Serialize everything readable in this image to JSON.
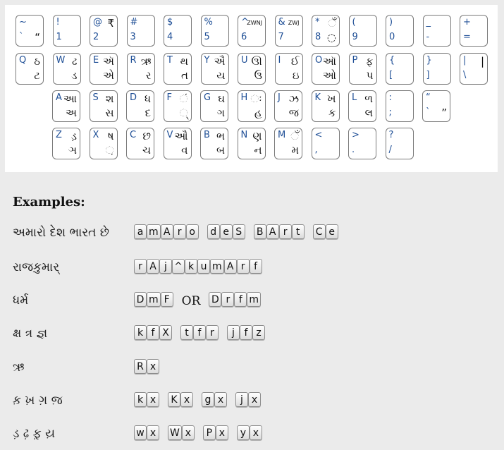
{
  "keyboard": {
    "rows": [
      [
        {
          "shift": "~",
          "base": "`",
          "gs": "",
          "gb": "“"
        },
        {
          "shift": "!",
          "base": "1",
          "gs": "",
          "gb": ""
        },
        {
          "shift": "@",
          "base": "2",
          "gs": "₹",
          "gb": ""
        },
        {
          "shift": "#",
          "base": "3",
          "gs": "",
          "gb": ""
        },
        {
          "shift": "$",
          "base": "4",
          "gs": "",
          "gb": ""
        },
        {
          "shift": "%",
          "base": "5",
          "gs": "",
          "gb": ""
        },
        {
          "shift": "^",
          "base": "6",
          "gs": "ZWNJ",
          "gb": "",
          "tiny": true
        },
        {
          "shift": "&",
          "base": "7",
          "gs": "ZWJ",
          "gb": "",
          "tiny": true
        },
        {
          "shift": "*",
          "base": "8",
          "gs": "ઁ",
          "gb": "◌"
        },
        {
          "shift": "(",
          "base": "9",
          "gs": "",
          "gb": ""
        },
        {
          "shift": ")",
          "base": "0",
          "gs": "",
          "gb": ""
        },
        {
          "shift": "_",
          "base": "-",
          "gs": "",
          "gb": ""
        },
        {
          "shift": "+",
          "base": "=",
          "gs": "",
          "gb": ""
        }
      ],
      [
        {
          "shift": "Q",
          "base": "",
          "gs": "ઠ",
          "gb": "ટ"
        },
        {
          "shift": "W",
          "base": "",
          "gs": "ઢ",
          "gb": "ડ"
        },
        {
          "shift": "E",
          "base": "",
          "gs": "ઍ",
          "gb": "એ"
        },
        {
          "shift": "R",
          "base": "",
          "gs": "ઋ",
          "gb": "ર"
        },
        {
          "shift": "T",
          "base": "",
          "gs": "થ",
          "gb": "ત"
        },
        {
          "shift": "Y",
          "base": "",
          "gs": "ઐ",
          "gb": "ય"
        },
        {
          "shift": "U",
          "base": "",
          "gs": "ઊ",
          "gb": "ઉ"
        },
        {
          "shift": "I",
          "base": "",
          "gs": "ઈ",
          "gb": "ઇ"
        },
        {
          "shift": "O",
          "base": "",
          "gs": "ઑ",
          "gb": "ઓ"
        },
        {
          "shift": "P",
          "base": "",
          "gs": "ફ",
          "gb": "પ"
        },
        {
          "shift": "{",
          "base": "[",
          "gs": "",
          "gb": ""
        },
        {
          "shift": "}",
          "base": "]",
          "gs": "",
          "gb": ""
        },
        {
          "shift": "|",
          "base": "\\",
          "gs": "|",
          "gb": ""
        }
      ],
      [
        {
          "shift": "A",
          "base": "",
          "gs": "આ",
          "gb": "અ"
        },
        {
          "shift": "S",
          "base": "",
          "gs": "શ",
          "gb": "સ"
        },
        {
          "shift": "D",
          "base": "",
          "gs": "ધ",
          "gb": "દ"
        },
        {
          "shift": "F",
          "base": "",
          "gs": "ં",
          "gb": "્"
        },
        {
          "shift": "G",
          "base": "",
          "gs": "ઘ",
          "gb": "ગ"
        },
        {
          "shift": "H",
          "base": "",
          "gs": "ઃ",
          "gb": "હ"
        },
        {
          "shift": "J",
          "base": "",
          "gs": "ઝ",
          "gb": "જ"
        },
        {
          "shift": "K",
          "base": "",
          "gs": "ખ",
          "gb": "ક"
        },
        {
          "shift": "L",
          "base": "",
          "gs": "ળ",
          "gb": "લ"
        },
        {
          "shift": ":",
          "base": ";",
          "gs": "",
          "gb": ""
        },
        {
          "shift": "“",
          "base": "`",
          "gs": "",
          "gb": "”"
        }
      ],
      [
        {
          "shift": "Z",
          "base": "",
          "gs": "ડ઼",
          "gb": "ઞ"
        },
        {
          "shift": "X",
          "base": "",
          "gs": "ષ",
          "gb": "઼"
        },
        {
          "shift": "C",
          "base": "",
          "gs": "છ",
          "gb": "ચ"
        },
        {
          "shift": "V",
          "base": "",
          "gs": "ઔ",
          "gb": "વ"
        },
        {
          "shift": "B",
          "base": "",
          "gs": "ભ",
          "gb": "બ"
        },
        {
          "shift": "N",
          "base": "",
          "gs": "ણ",
          "gb": "ન"
        },
        {
          "shift": "M",
          "base": "",
          "gs": "ઁ",
          "gb": "મ"
        },
        {
          "shift": "<",
          "base": ",",
          "gs": "",
          "gb": ""
        },
        {
          "shift": ">",
          "base": ".",
          "gs": "",
          "gb": ""
        },
        {
          "shift": "?",
          "base": "/",
          "gs": "",
          "gb": ""
        }
      ]
    ]
  },
  "examples": {
    "heading": "Examples:",
    "or_label": "OR",
    "items": [
      {
        "word": "અમારો દેશ ભારત છે",
        "groups": [
          [
            "a",
            "m",
            "A",
            "r",
            "o"
          ],
          [
            "d",
            "e",
            "S"
          ],
          [
            "B",
            "A",
            "r",
            "t"
          ],
          [
            "C",
            "e"
          ]
        ]
      },
      {
        "word": "રાજકુમાર્",
        "groups": [
          [
            "r",
            "A",
            "j",
            "^",
            "k",
            "u",
            "m",
            "A",
            "r",
            "f"
          ]
        ]
      },
      {
        "word": "ધર્મ",
        "groups": [
          [
            "D",
            "m",
            "F"
          ],
          "OR",
          [
            "D",
            "r",
            "f",
            "m"
          ]
        ]
      },
      {
        "word": "ક્ષ ત્ર જ્ઞ",
        "groups": [
          [
            "k",
            "f",
            "X"
          ],
          [
            "t",
            "f",
            "r"
          ],
          [
            "j",
            "f",
            "z"
          ]
        ]
      },
      {
        "word": "ઋ",
        "groups": [
          [
            "R",
            "x"
          ]
        ]
      },
      {
        "word": "ક઼ ખ઼ ગ઼ જ઼",
        "groups": [
          [
            "k",
            "x"
          ],
          [
            "K",
            "x"
          ],
          [
            "g",
            "x"
          ],
          [
            "j",
            "x"
          ]
        ]
      },
      {
        "word": "ડ઼ ઢ઼ ફ઼ ય઼",
        "groups": [
          [
            "w",
            "x"
          ],
          [
            "W",
            "x"
          ],
          [
            "P",
            "x"
          ],
          [
            "y",
            "x"
          ]
        ]
      }
    ]
  }
}
